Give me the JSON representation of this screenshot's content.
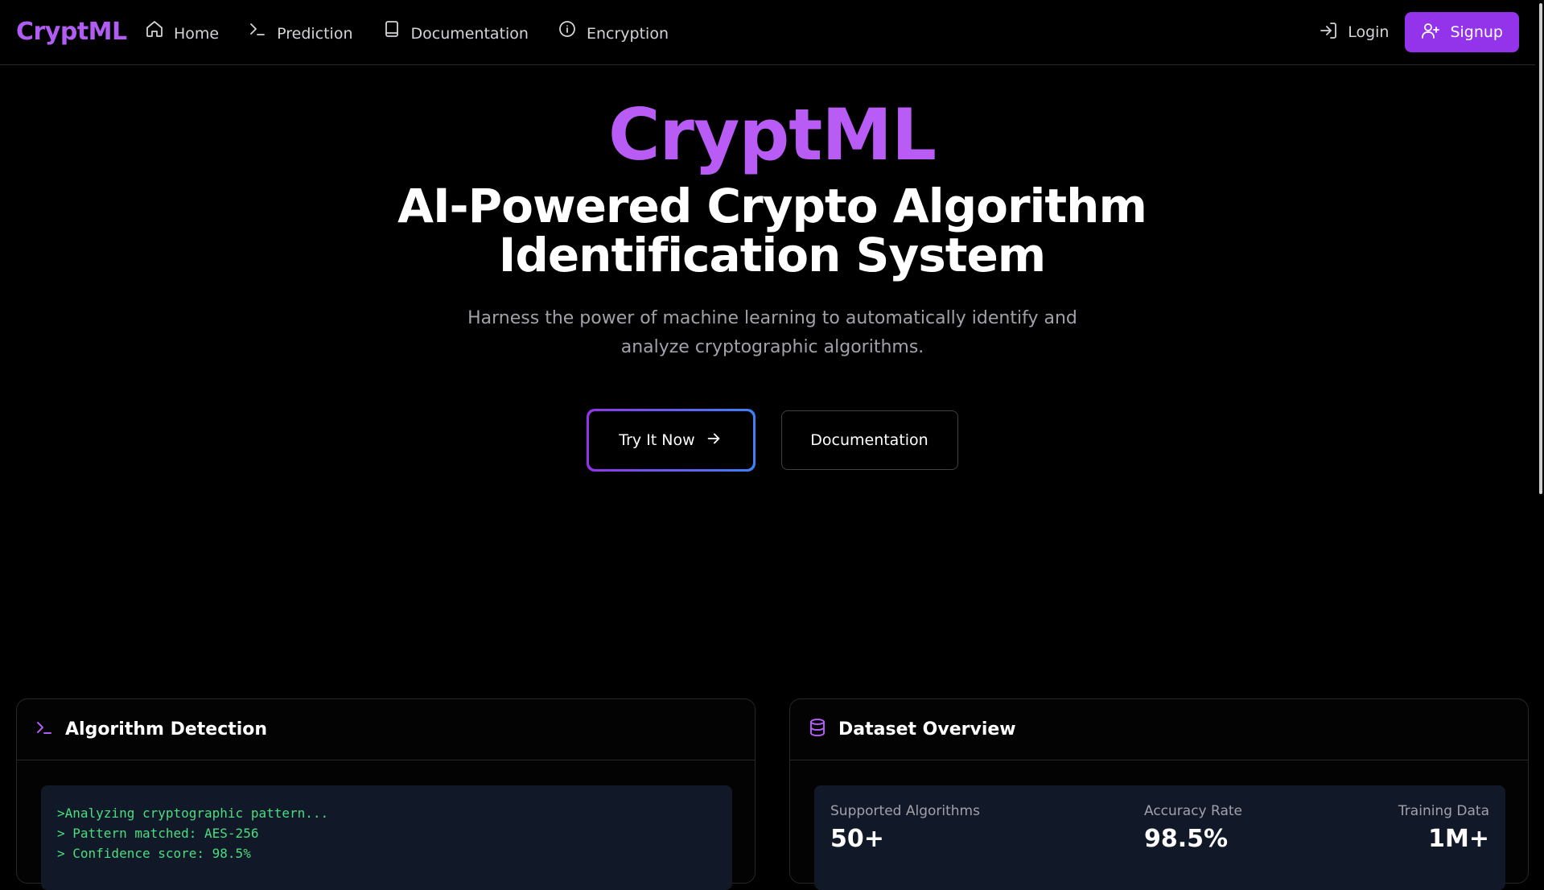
{
  "nav": {
    "brand": "CryptML",
    "links": [
      {
        "label": "Home",
        "icon": "home-icon"
      },
      {
        "label": "Prediction",
        "icon": "terminal-icon"
      },
      {
        "label": "Documentation",
        "icon": "book-icon"
      },
      {
        "label": "Encryption",
        "icon": "info-icon"
      }
    ],
    "login_label": "Login",
    "signup_label": "Signup"
  },
  "hero": {
    "title": "CryptML",
    "subtitle_line1": "AI-Powered Crypto Algorithm",
    "subtitle_line2": "Identification System",
    "description": "Harness the power of machine learning to automatically identify and analyze cryptographic algorithms.",
    "primary_button": "Try It Now",
    "secondary_button": "Documentation"
  },
  "detection_card": {
    "title": "Algorithm Detection",
    "terminal_lines": [
      ">Analyzing cryptographic pattern...",
      "> Pattern matched: AES-256",
      "> Confidence score: 98.5%"
    ]
  },
  "dataset_card": {
    "title": "Dataset Overview",
    "stats": [
      {
        "label": "Supported Algorithms",
        "value": "50+"
      },
      {
        "label": "Accuracy Rate",
        "value": "98.5%"
      },
      {
        "label": "Training Data",
        "value": "1M+"
      }
    ]
  },
  "colors": {
    "brand_purple": "#b15cf2",
    "signup_bg": "#9333ea",
    "gradient_start": "#9333ea",
    "gradient_end": "#3b82f6",
    "terminal_text": "#4ade80"
  }
}
